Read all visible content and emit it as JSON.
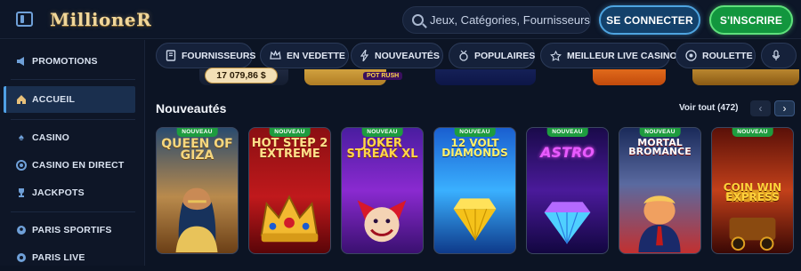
{
  "header": {
    "logo": "MillioneR",
    "search_placeholder": "Jeux, Catégories, Fournisseurs",
    "login_label": "SE CONNECTER",
    "signup_label": "S'INSCRIRE"
  },
  "sidebar": {
    "items": [
      {
        "label": "PROMOTIONS",
        "icon": "megaphone-icon"
      },
      {
        "label": "ACCUEIL",
        "icon": "home-icon"
      },
      {
        "label": "CASINO",
        "icon": "spade-icon"
      },
      {
        "label": "CASINO EN DIRECT",
        "icon": "chip-icon"
      },
      {
        "label": "JACKPOTS",
        "icon": "trophy-icon"
      },
      {
        "label": "PARIS SPORTIFS",
        "icon": "football-icon"
      },
      {
        "label": "PARIS LIVE",
        "icon": "live-icon"
      }
    ]
  },
  "tabs": [
    {
      "label": "FOURNISSEURS",
      "icon": "book-icon"
    },
    {
      "label": "EN VEDETTE",
      "icon": "crown-icon"
    },
    {
      "label": "NOUVEAUTÉS",
      "icon": "lightning-icon"
    },
    {
      "label": "POPULAIRES",
      "icon": "medal-icon"
    },
    {
      "label": "MEILLEUR LIVE CASINO",
      "icon": "star-icon"
    },
    {
      "label": "ROULETTE",
      "icon": "roulette-icon"
    },
    {
      "label": "",
      "icon": "microphone-icon"
    }
  ],
  "strip": {
    "jackpot_value": "17 079,86 $",
    "pot_rush": "POT RUSH"
  },
  "section": {
    "title": "Nouveautés",
    "see_all": "Voir tout (472)"
  },
  "games": [
    {
      "title": "QUEEN OF GIZA",
      "badge": "NOUVEAU"
    },
    {
      "title": "HOT STEP 2 EXTREME",
      "badge": "NOUVEAU"
    },
    {
      "title": "JOKER STREAK XL",
      "badge": "NOUVEAU"
    },
    {
      "title": "12 VOLT DIAMONDS",
      "badge": "NOUVEAU"
    },
    {
      "title": "ASTRO",
      "badge": "NOUVEAU"
    },
    {
      "title": "MORTAL BROMANCE",
      "badge": "NOUVEAU"
    },
    {
      "title": "COIN WIN EXPRESS",
      "badge": "NOUVEAU"
    }
  ]
}
